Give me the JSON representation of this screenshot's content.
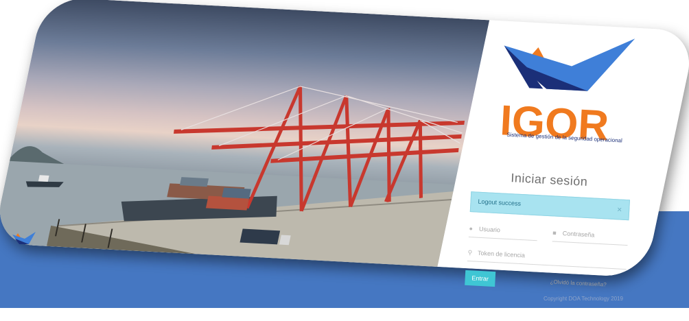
{
  "login": {
    "logo_text": "IGOR",
    "tagline": "Sistema de gestión de la seguridad operacional",
    "title": "Iniciar sesión",
    "alert_text": "Logout success",
    "alert_close": "×",
    "username_placeholder": "Usuario",
    "password_placeholder": "Contraseña",
    "token_placeholder": "Token de licencia",
    "submit_label": "Entrar",
    "forgot_link": "¿Olvidó la contraseña?"
  },
  "footer": {
    "copyright": "Copyright DOA Technology 2019"
  },
  "colors": {
    "brand_orange": "#f07a1f",
    "brand_blue": "#1b2f78",
    "accent_cyan": "#3fc6d4",
    "background_blue": "#4577c2"
  },
  "icons": {
    "user": "user-icon",
    "lock": "lock-icon",
    "key": "key-icon",
    "close": "close-icon"
  }
}
